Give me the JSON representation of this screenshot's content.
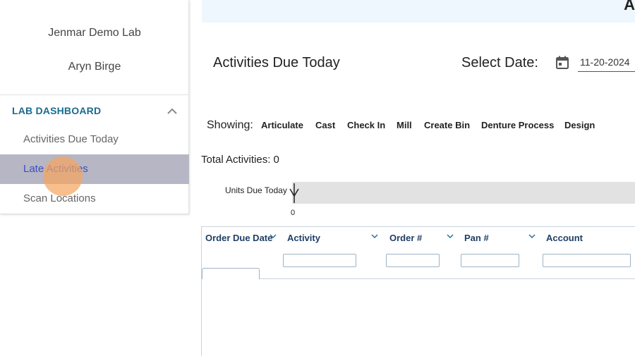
{
  "sidebar": {
    "org_name": "Jenmar Demo Lab",
    "user_name": "Aryn Birge",
    "section_title": "LAB DASHBOARD",
    "items": [
      {
        "label": "Activities Due Today",
        "active": false
      },
      {
        "label": "Late Activities",
        "active": true
      },
      {
        "label": "Scan Locations",
        "active": false
      }
    ]
  },
  "header": {
    "banner_text": "A"
  },
  "main": {
    "title": "Activities Due Today",
    "date_label": "Select Date:",
    "date_value": "11-20-2024",
    "showing_label": "Showing:",
    "filters": [
      "Articulate",
      "Cast",
      "Check In",
      "Mill",
      "Create Bin",
      "Denture Process",
      "Design"
    ],
    "total_label": "Total Activities: 0",
    "chart_label": "Units Due Today",
    "chart_axis_value": "0"
  },
  "table": {
    "columns": [
      {
        "label": "Order Due Date"
      },
      {
        "label": "Activity"
      },
      {
        "label": "Order #"
      },
      {
        "label": "Pan #"
      },
      {
        "label": "Account"
      }
    ],
    "rows": []
  },
  "colors": {
    "accent": "#1a6b8f",
    "active_item_bg": "#b6b6c4",
    "active_item_text": "#3a4ec0",
    "banner_bg": "#eef6fe",
    "table_header_text": "#1f3f66"
  },
  "icons": [
    "chevron-up-icon",
    "calendar-icon",
    "chevron-down-icon",
    "cursor-icon"
  ]
}
